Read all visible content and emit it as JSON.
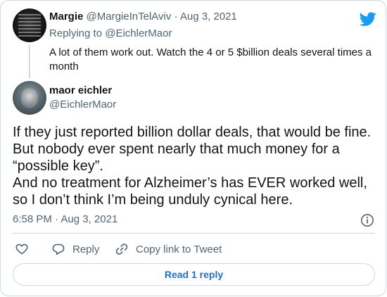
{
  "parent_tweet": {
    "author_name": "Margie",
    "author_handle": "@MargieInTelAviv",
    "separator": "·",
    "date": "Aug 3, 2021",
    "replying_prefix": "Replying to",
    "replying_to": "@EichlerMaor",
    "text": "A lot of them work out. Watch the 4 or 5 $billion deals several times a month"
  },
  "main_tweet": {
    "author_name": "maor eichler",
    "author_handle": "@EichlerMaor",
    "text_lines": [
      "If they just reported billion dollar deals, that would be fine.",
      "But nobody ever spent nearly that much money for a",
      "“possible key”.",
      "And no treatment for Alzheimer’s has EVER worked well,",
      "so I don’t think I’m being unduly cynical here."
    ],
    "time": "6:58 PM",
    "separator": "·",
    "date": "Aug 3, 2021"
  },
  "actions": {
    "reply_label": "Reply",
    "copy_link_label": "Copy link to Tweet"
  },
  "read_replies_label": "Read 1 reply",
  "colors": {
    "brand": "#1d9bf0",
    "link": "#1d70c4",
    "muted": "#536471",
    "border": "#cfd9de"
  }
}
